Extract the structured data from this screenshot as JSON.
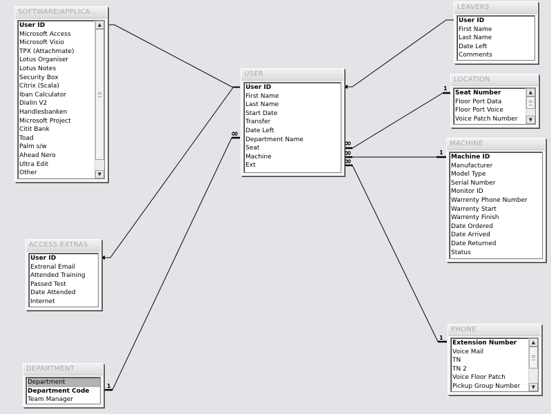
{
  "tables": {
    "software": {
      "title": "SOFTWARE/APPLICA...",
      "fields": [
        "User ID",
        "Microsoft Access",
        "Microsoft Visio",
        "TPX (Attachmate)",
        "Lotus Organiser",
        "Lotus Notes",
        "Security Box",
        "Citrix (Scala)",
        "Iban Calculator",
        "Dialin V2",
        "Handlesbanken",
        "Microsoft Project",
        "Citit Bank",
        "Toad",
        "Palm s/w",
        "Ahead Nero",
        "Ultra Edit",
        "Other"
      ],
      "key_fields": [
        "User ID"
      ]
    },
    "user": {
      "title": "USER",
      "fields": [
        "User ID",
        "First Name",
        "Last Name",
        "Start Date",
        "Transfer",
        "Date Left",
        "Department Name",
        "Seat",
        "Machine",
        "Ext"
      ],
      "key_fields": [
        "User ID"
      ]
    },
    "leavers": {
      "title": "LEAVERS",
      "fields": [
        "User ID",
        "First Name",
        "Last Name",
        "Date Left",
        "Comments"
      ],
      "key_fields": [
        "User ID"
      ]
    },
    "location": {
      "title": "LOCATION",
      "fields": [
        "Seat Number",
        "Floor Port Data",
        "Floor Port Voice",
        "Voice Patch Number"
      ],
      "key_fields": [
        "Seat Number"
      ]
    },
    "machine": {
      "title": "MACHINE",
      "fields": [
        "Machine ID",
        "Manufacturer",
        "Model Type",
        "Serial Number",
        "Monitor ID",
        "Warrenty Phone Number",
        "Warrenty Start",
        "Warrenty Finish",
        "Date Ordered",
        "Date Arrived",
        "Date Returned",
        "Status"
      ],
      "key_fields": [
        "Machine ID"
      ]
    },
    "access_extras": {
      "title": "ACCESS EXTRAS",
      "fields": [
        "User ID",
        "Extrenal Email",
        "Attended Training",
        "Passed Test",
        "Date Attended",
        "Internet"
      ],
      "key_fields": [
        "User ID"
      ]
    },
    "department": {
      "title": "DEPARTMENT",
      "fields": [
        "Department",
        "Department Code",
        "Team Manager"
      ],
      "key_fields": [
        "Department Code"
      ],
      "selected_field": "Department"
    },
    "phone": {
      "title": "PHONE",
      "fields": [
        "Extension Number",
        "Voice Mail",
        "TN",
        "TN 2",
        "Voice Floor Patch",
        "Pickup Group Number"
      ],
      "key_fields": [
        "Extension Number"
      ]
    }
  },
  "cardinality": {
    "one": "1",
    "many": "∞"
  },
  "colors": {
    "background": "#e4e3e7",
    "line": "#000000",
    "title_text": "#a9a9a9",
    "selected_row": "#b3b3b3"
  }
}
